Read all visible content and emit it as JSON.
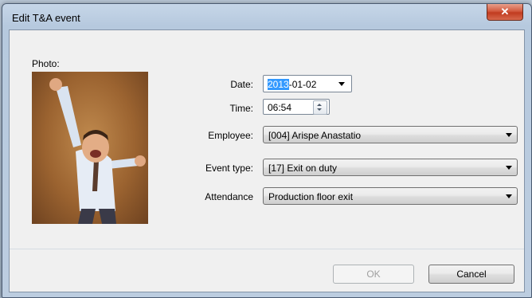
{
  "window": {
    "title": "Edit T&A event",
    "close_glyph": "✕"
  },
  "photo": {
    "label": "Photo:"
  },
  "form": {
    "date": {
      "label": "Date:",
      "year": "2013",
      "rest": "-01-02"
    },
    "time": {
      "label": "Time:",
      "value": "06:54"
    },
    "employee": {
      "label": "Employee:",
      "value": "[004]  Arispe Anastatio"
    },
    "event_type": {
      "label": "Event type:",
      "value": "[17]  Exit on duty"
    },
    "attendance": {
      "label": "Attendance",
      "value": "Production floor exit"
    }
  },
  "buttons": {
    "ok": "OK",
    "cancel": "Cancel"
  }
}
